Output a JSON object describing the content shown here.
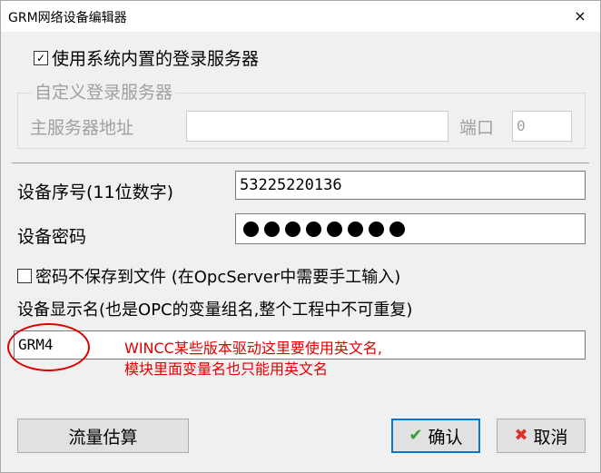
{
  "window": {
    "title": "GRM网络设备编辑器",
    "close_label": "×"
  },
  "login": {
    "use_builtin_label": "使用系统内置的登录服务器",
    "use_builtin_checked": true,
    "custom_group_label": "自定义登录服务器",
    "main_server_label": "主服务器地址",
    "main_server_value": "",
    "port_label": "端口",
    "port_value": "0"
  },
  "device": {
    "serial_label": "设备序号(11位数字)",
    "serial_value": "53225220136",
    "password_label": "设备密码",
    "password_dot_count": 8,
    "no_save_label": "密码不保存到文件 (在OpcServer中需要手工输入)",
    "no_save_checked": false,
    "display_name_label": "设备显示名(也是OPC的变量组名,整个工程中不可重复)",
    "display_name_value": "GRM4"
  },
  "annotation": {
    "line1": "WINCC某些版本驱动这里要使用英文名,",
    "line2": "模块里面变量名也只能用英文名",
    "color": "#e00000"
  },
  "buttons": {
    "estimate_label": "流量估算",
    "ok_label": "确认",
    "cancel_label": "取消",
    "ok_icon": "checkmark-icon",
    "cancel_icon": "x-icon"
  },
  "colors": {
    "default_button_border": "#0078d7",
    "ok_icon": "#3a9a3a",
    "cancel_icon": "#d9332b"
  }
}
